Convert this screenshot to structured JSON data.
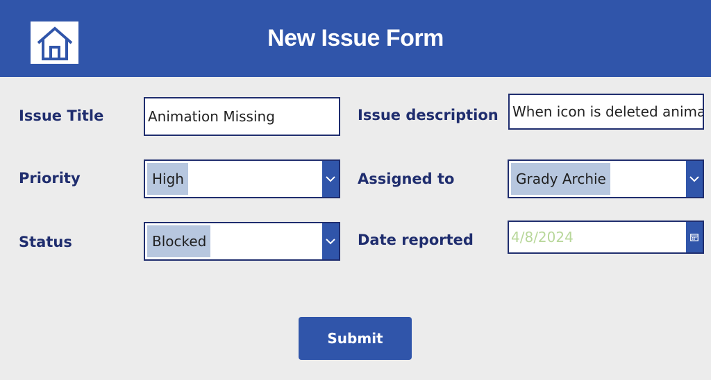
{
  "header": {
    "title": "New Issue Form",
    "home_icon": "home-icon"
  },
  "form": {
    "issue_title": {
      "label": "Issue Title",
      "value": "Animation Missing"
    },
    "issue_description": {
      "label": "Issue description",
      "value": "When icon is deleted animation is missing"
    },
    "priority": {
      "label": "Priority",
      "value": "High",
      "icon": "chevron-down-icon"
    },
    "assigned_to": {
      "label": "Assigned to",
      "value": "Grady Archie",
      "icon": "chevron-down-icon"
    },
    "status": {
      "label": "Status",
      "value": "Blocked",
      "icon": "chevron-down-icon"
    },
    "date_reported": {
      "label": "Date reported",
      "value": "4/8/2024",
      "icon": "calendar-icon"
    }
  },
  "submit": {
    "label": "Submit"
  },
  "colors": {
    "brand": "#3055aa",
    "label_text": "#1f2d6e",
    "chip": "#b7c7df",
    "date_text": "#b8d79a",
    "background": "#ececec"
  }
}
